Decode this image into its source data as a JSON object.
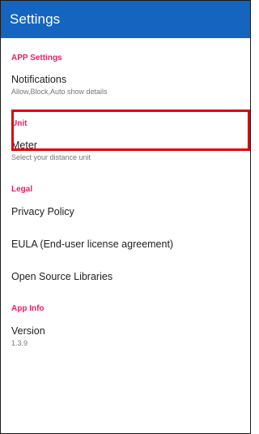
{
  "app_bar": {
    "title": "Settings"
  },
  "sections": {
    "app_settings": {
      "header": "APP Settings",
      "notifications": {
        "title": "Notifications",
        "summary": "Allow,Block,Auto show details"
      }
    },
    "unit": {
      "header": "Unit",
      "meter": {
        "title": "Meter",
        "summary": "Select your distance unit"
      }
    },
    "legal": {
      "header": "Legal",
      "privacy": {
        "title": "Privacy Policy"
      },
      "eula": {
        "title": "EULA (End-user license agreement)"
      },
      "open_source": {
        "title": "Open Source Libraries"
      }
    },
    "app_info": {
      "header": "App Info",
      "version": {
        "title": "Version",
        "summary": "1.3.9"
      }
    }
  },
  "colors": {
    "app_bar": "#1565c0",
    "section_header": "#e91e63",
    "highlight": "#e00000"
  }
}
